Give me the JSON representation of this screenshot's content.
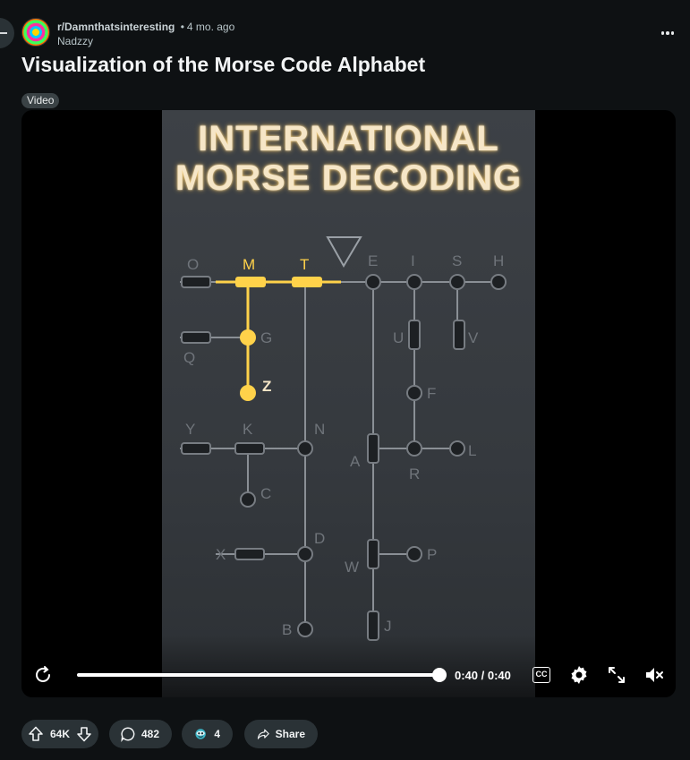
{
  "post": {
    "subreddit": "r/Damnthatsinteresting",
    "separator": "•",
    "time_ago": "4 mo. ago",
    "author": "Nadzzy",
    "title": "Visualization of the Morse Code Alphabet",
    "flair": "Video"
  },
  "video": {
    "frame_title_line1": "INTERNATIONAL",
    "frame_title_line2": "MORSE DECODING",
    "tree_letters": [
      "O",
      "M",
      "T",
      "E",
      "I",
      "S",
      "H",
      "G",
      "Q",
      "U",
      "V",
      "Z",
      "F",
      "Y",
      "K",
      "N",
      "A",
      "R",
      "L",
      "C",
      "D",
      "X",
      "W",
      "P",
      "B",
      "J"
    ],
    "time_display": "0:40 / 0:40",
    "progress": 1.0,
    "muted": true,
    "cc_label": "CC",
    "glow_color": "#ffd24a"
  },
  "actions": {
    "upvotes": "64K",
    "comments": "482",
    "awards": "4",
    "share_label": "Share"
  },
  "icons": {
    "back": "minus-icon",
    "more": "more-options-icon",
    "replay": "replay-icon",
    "settings": "gear-icon",
    "fullscreen": "expand-icon",
    "mute": "speaker-muted-icon",
    "upvote": "arrow-up-icon",
    "downvote": "arrow-down-icon",
    "comment": "comment-bubble-icon",
    "award": "award-icon",
    "share": "share-arrow-icon"
  }
}
